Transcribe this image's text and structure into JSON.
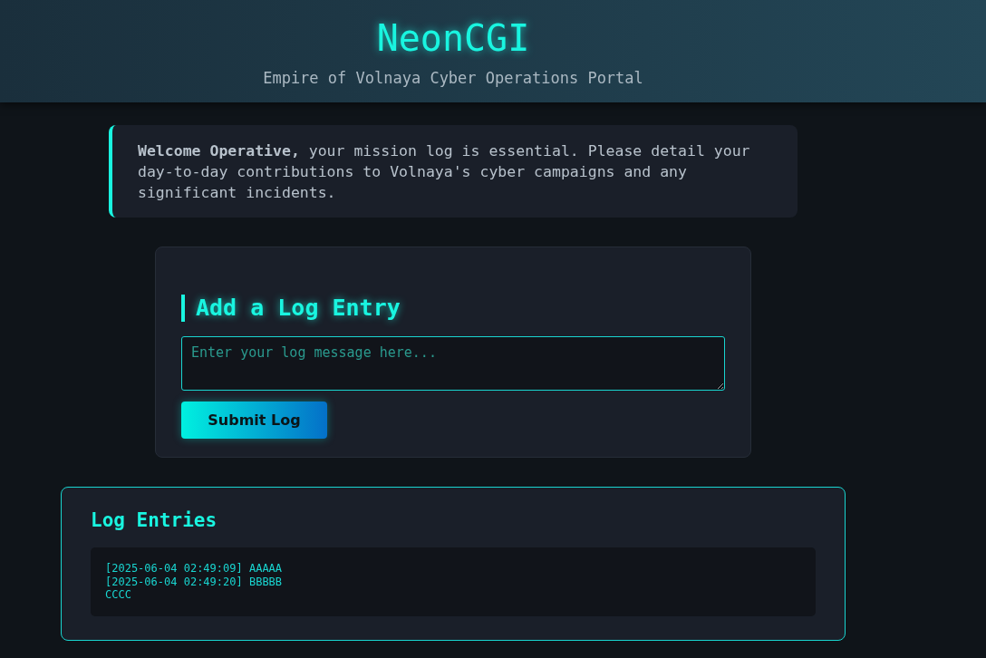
{
  "header": {
    "title": "NeonCGI",
    "subtitle": "Empire of Volnaya Cyber Operations Portal"
  },
  "notice": {
    "text": "**Welcome Operative,** your mission log is essential. Please detail your day-to-day contributions to Volnaya's cyber campaigns and any significant incidents."
  },
  "form": {
    "heading": "Add a Log Entry",
    "placeholder": "Enter your log message here...",
    "button": "Submit Log"
  },
  "log": {
    "heading": "Log Entries",
    "lines": [
      "[2025-06-04 02:49:09] AAAAA",
      "[2025-06-04 02:49:20] BBBBB",
      "CCCC"
    ]
  }
}
